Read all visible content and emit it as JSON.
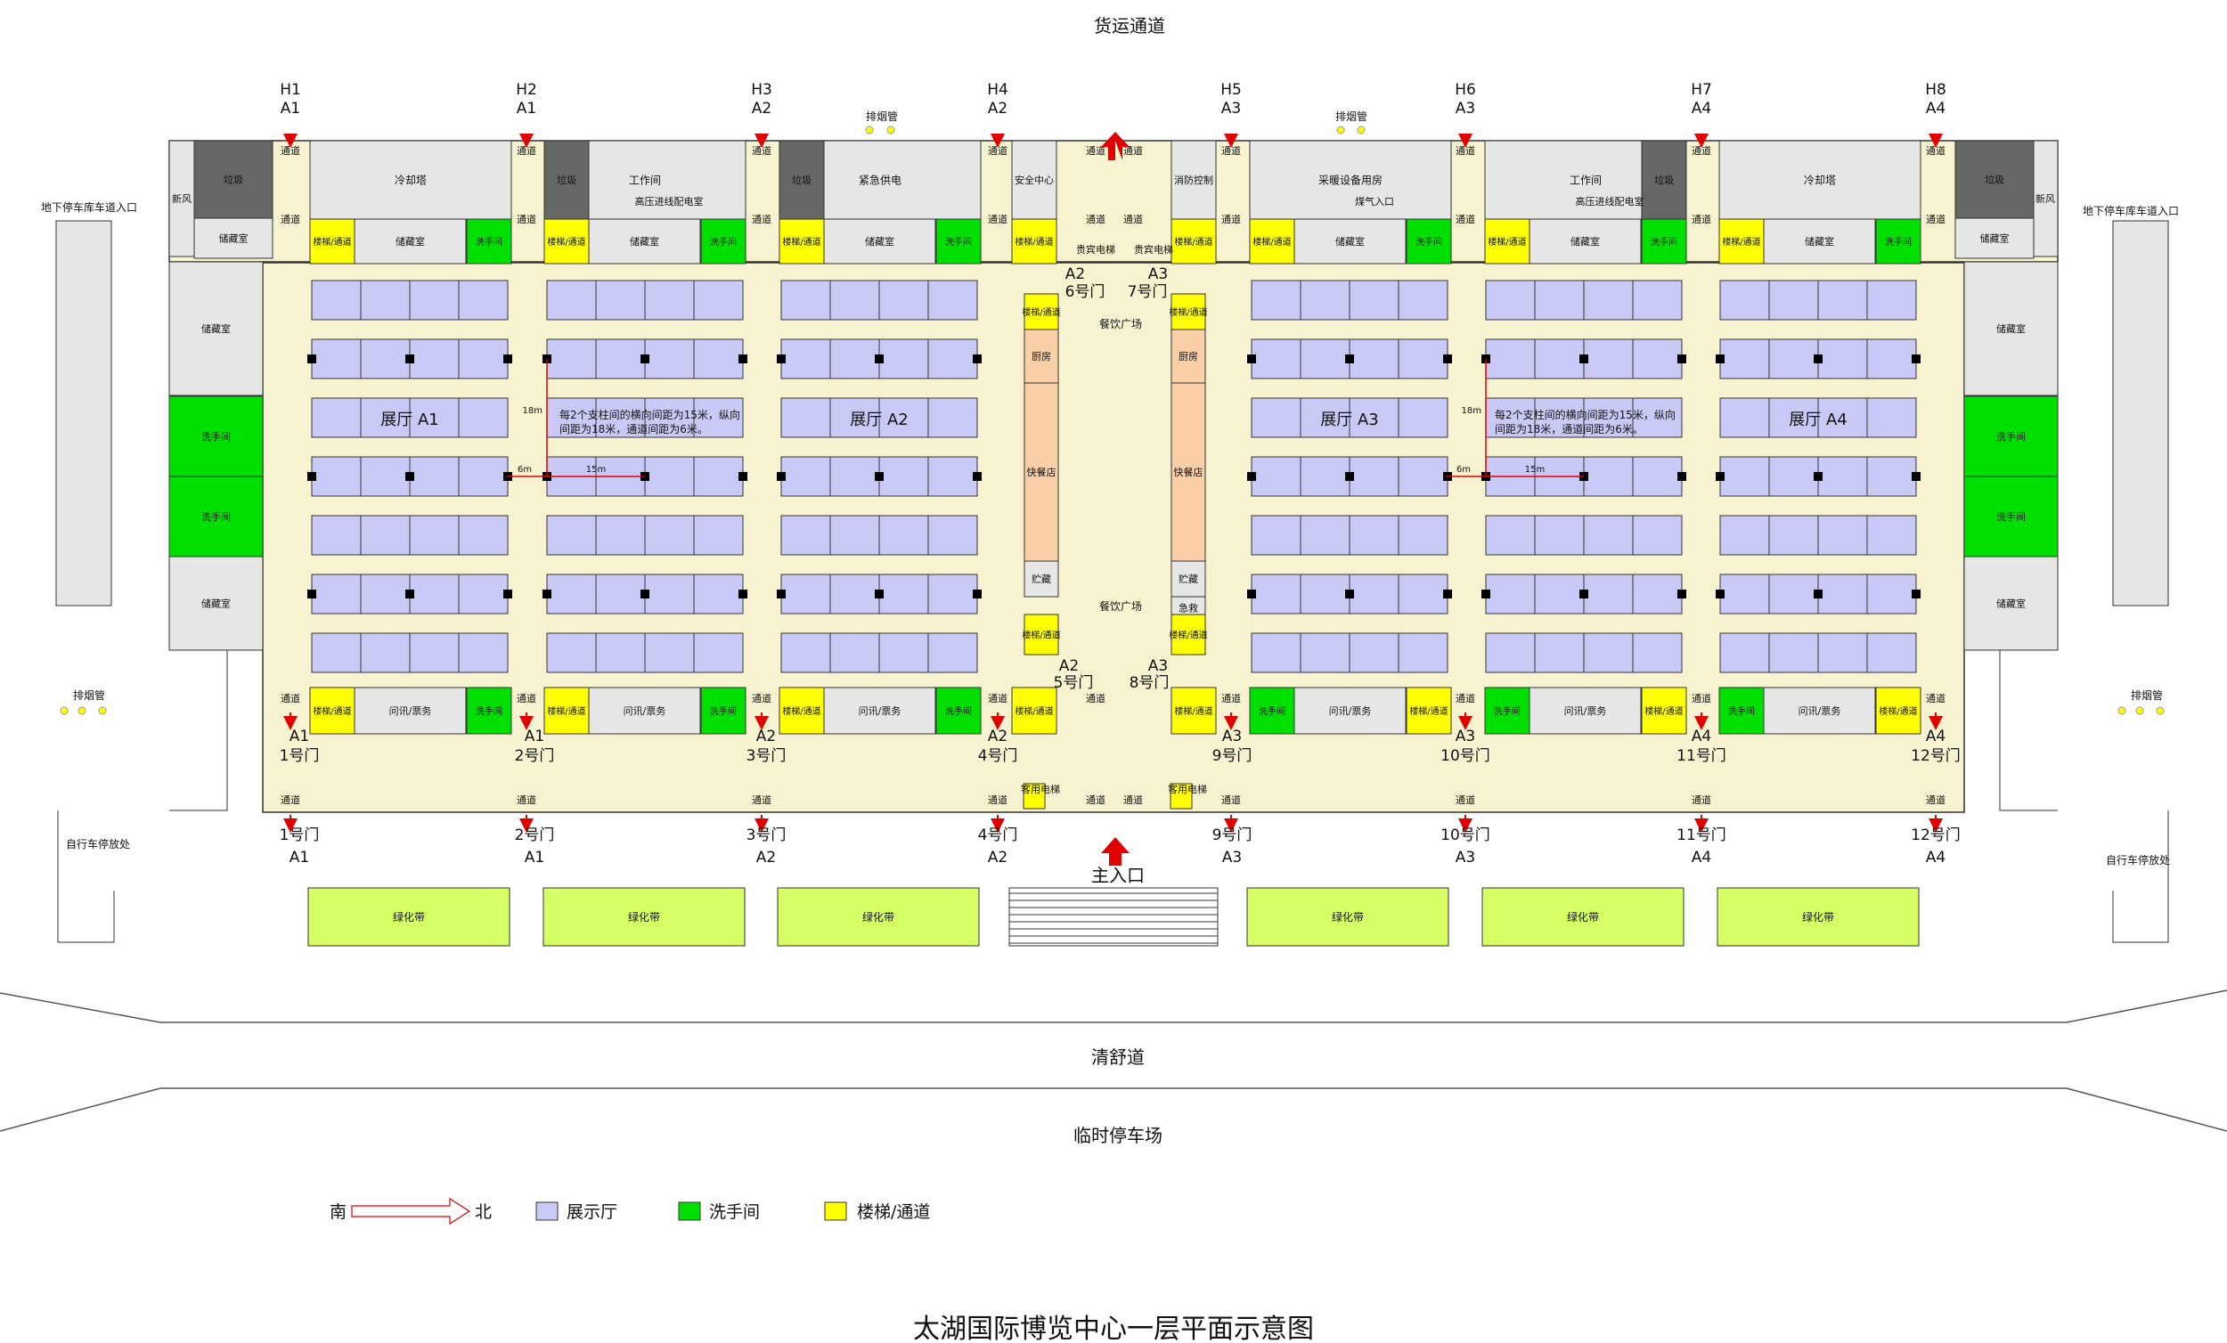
{
  "title": "太湖国际博览中心一层平面示意图",
  "roads": {
    "top": "货运通道",
    "middle": "清舒道",
    "bottom": "临时停车场",
    "main_entrance": "主入口"
  },
  "side": {
    "parking_ramp": "地下停车库车道入口",
    "bike": "自行车停放处",
    "smoke": "排烟管"
  },
  "top_gates": [
    {
      "code": "H1",
      "hall": "A1"
    },
    {
      "code": "H2",
      "hall": "A1"
    },
    {
      "code": "H3",
      "hall": "A2"
    },
    {
      "code": "H4",
      "hall": "A2"
    },
    {
      "code": "H5",
      "hall": "A3"
    },
    {
      "code": "H6",
      "hall": "A3"
    },
    {
      "code": "H7",
      "hall": "A4"
    },
    {
      "code": "H8",
      "hall": "A4"
    }
  ],
  "doors": [
    {
      "name": "1号门",
      "hall": "A1"
    },
    {
      "name": "2号门",
      "hall": "A1"
    },
    {
      "name": "3号门",
      "hall": "A2"
    },
    {
      "name": "4号门",
      "hall": "A2"
    },
    {
      "name": "9号门",
      "hall": "A3"
    },
    {
      "name": "10号门",
      "hall": "A3"
    },
    {
      "name": "11号门",
      "hall": "A4"
    },
    {
      "name": "12号门",
      "hall": "A4"
    }
  ],
  "center_doors": [
    {
      "name": "6号门",
      "hall": "A2"
    },
    {
      "name": "7号门",
      "hall": "A3"
    },
    {
      "name": "5号门",
      "hall": "A2"
    },
    {
      "name": "8号门",
      "hall": "A3"
    }
  ],
  "halls": [
    "展厅 A1",
    "展厅 A2",
    "展厅 A3",
    "展厅 A4"
  ],
  "rooms": {
    "passage": "通道",
    "garbage": "垃圾",
    "fresh_air": "新风",
    "storage": "储藏室",
    "cooling_tower": "冷却塔",
    "stair": "楼梯/通道",
    "washroom": "洗手间",
    "workroom": "工作间",
    "hv_room": "高压进线配电室",
    "emergency_power": "紧急供电",
    "security": "安全中心",
    "fire_control": "消防控制",
    "gas_inlet": "煤气入口",
    "hvac_room": "采暖设备用房",
    "vip_lift": "贵宾电梯",
    "info_ticket": "问讯/票务",
    "dining_plaza": "餐饮广场",
    "kitchen": "厨房",
    "fast_food": "快餐店",
    "storeroom": "贮藏",
    "first_aid": "急救",
    "guest_lift": "客用电梯",
    "green_belt": "绿化带"
  },
  "note": {
    "line1": "每2个支柱间的横向间距为15米，纵向",
    "line2": "间距为18米，通道间距为6米。",
    "dim_18": "18m",
    "dim_6": "6m",
    "dim_15": "15m"
  },
  "legend": {
    "south": "南",
    "north": "北",
    "hall": "展示厅",
    "washroom": "洗手间",
    "stair": "楼梯/通道"
  },
  "colors": {
    "hall": "#c9c9f5",
    "washroom": "#00e000",
    "stair": "#ffff00",
    "floor": "#f7f3d0",
    "room": "#e6e6e6",
    "dark": "#666666",
    "food": "#fbcfa8",
    "green_belt": "#d6ff66",
    "arrow": "#e00000"
  }
}
